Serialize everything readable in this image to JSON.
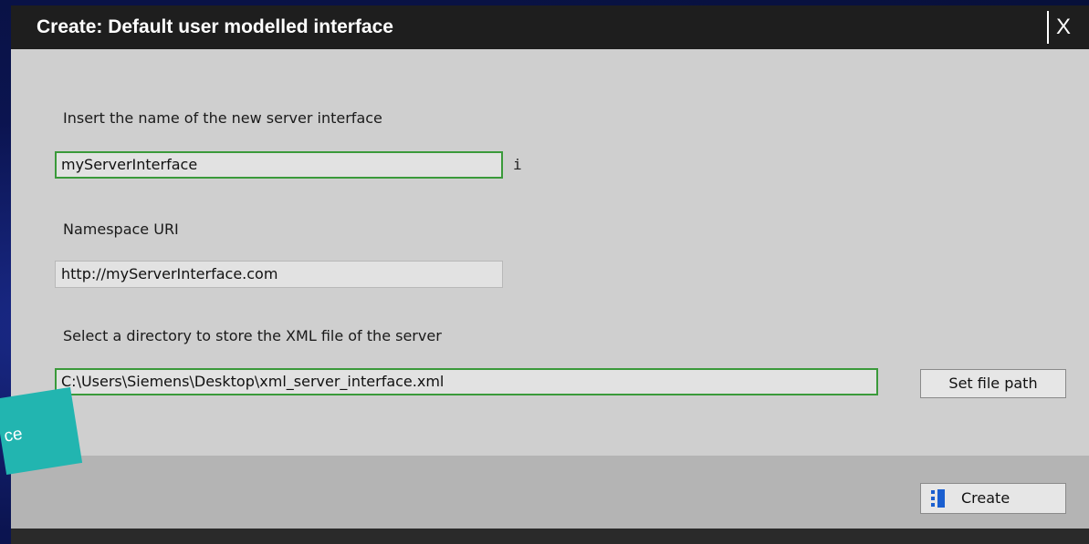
{
  "dialog": {
    "title": "Create: Default user modelled interface",
    "close_label": "X"
  },
  "form": {
    "name_label": "Insert the name of the new server interface",
    "name_value": "myServerInterface",
    "name_info": "i",
    "namespace_label": "Namespace URI",
    "namespace_value": "http://myServerInterface.com",
    "directory_label": "Select a directory to store the XML file of the server",
    "directory_value": "C:\\Users\\Siemens\\Desktop\\xml_server_interface.xml",
    "set_file_path_label": "Set file path"
  },
  "footer": {
    "create_label": "Create",
    "create_icon": "create-icon"
  },
  "callout": {
    "text": "ce"
  },
  "colors": {
    "title_bar": "#1e1e1e",
    "dialog_bg": "#cfcfcf",
    "footer_bg": "#b4b4b4",
    "valid_border": "#3a9a3a",
    "create_icon": "#1a5fd0",
    "callout_bg": "#22b5b0",
    "background": "#0b1450"
  }
}
